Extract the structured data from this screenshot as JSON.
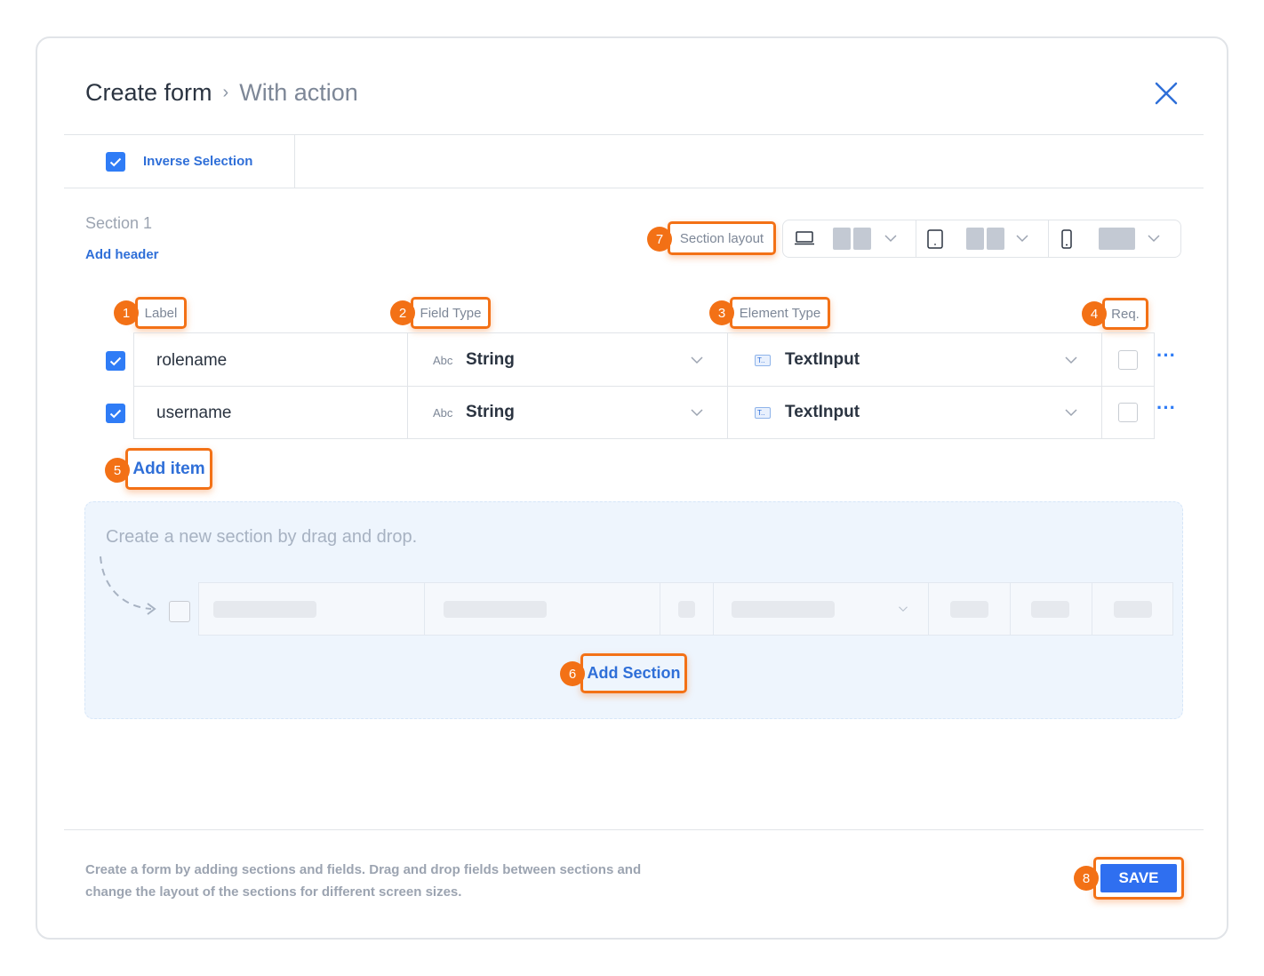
{
  "header": {
    "title": "Create form",
    "separator": "›",
    "subtitle": "With action"
  },
  "toolbar": {
    "inverse_selection_label": "Inverse Selection",
    "inverse_selection_checked": true
  },
  "section": {
    "title": "Section 1",
    "add_header_label": "Add header",
    "layout_label": "Section layout",
    "layout_devices": [
      "laptop-icon",
      "tablet-icon",
      "phone-icon"
    ]
  },
  "columns": {
    "label": "Label",
    "field_type": "Field Type",
    "element_type": "Element Type",
    "required": "Req."
  },
  "rows": [
    {
      "label": "rolename",
      "field_type_icon": "Abc",
      "field_type": "String",
      "element_type_icon": "T..",
      "element_type": "TextInput",
      "checked": true,
      "required": false,
      "more": "···"
    },
    {
      "label": "username",
      "field_type_icon": "Abc",
      "field_type": "String",
      "element_type_icon": "T..",
      "element_type": "TextInput",
      "checked": true,
      "required": false,
      "more": "···"
    }
  ],
  "add_item_label": "Add item",
  "drop_zone": {
    "hint": "Create a new section by drag and drop.",
    "add_section_label": "Add Section"
  },
  "footer": {
    "help_text": "Create a form by adding sections and fields. Drag and drop fields between sections and change the layout of the sections for different screen sizes.",
    "save_label": "SAVE"
  },
  "annotations": [
    "1",
    "2",
    "3",
    "4",
    "5",
    "6",
    "7",
    "8"
  ],
  "colors": {
    "accent": "#2f7cf6",
    "annotation": "#f37116",
    "link": "#2f6fd8"
  }
}
